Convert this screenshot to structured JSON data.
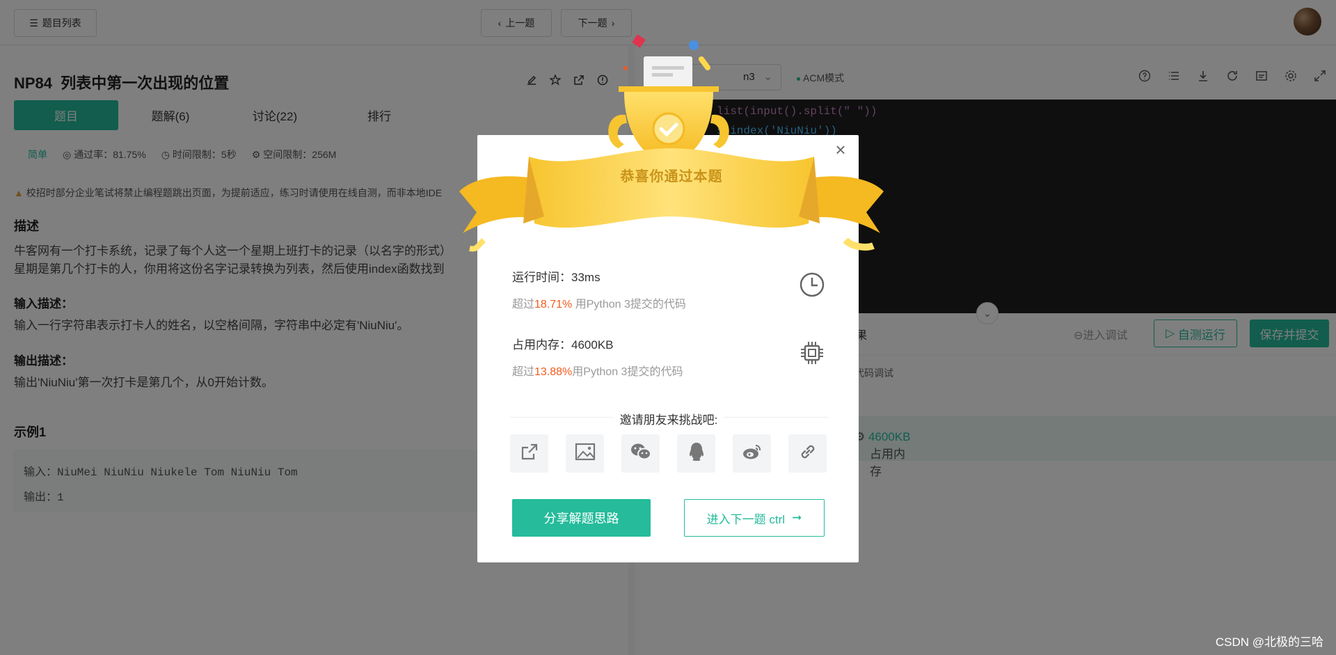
{
  "topbar": {
    "problem_list": "题目列表",
    "prev": "上一题",
    "next": "下一题"
  },
  "problem": {
    "id": "NP84",
    "title": "列表中第一次出现的位置",
    "tabs": [
      {
        "label": "题目",
        "active": true
      },
      {
        "label": "题解(6)",
        "active": false
      },
      {
        "label": "讨论(22)",
        "active": false
      },
      {
        "label": "排行",
        "active": false
      }
    ],
    "difficulty": "简单",
    "pass_rate": "通过率：81.75%",
    "time_limit": "时间限制：5秒",
    "space_limit": "空间限制：256M",
    "warning": "校招时部分企业笔试将禁止编程题跳出页面，为提前适应，练习时请使用在线自测，而非本地IDE",
    "desc_heading": "描述",
    "desc_line1": "牛客网有一个打卡系统，记录了每个人这一个星期上班打卡的记录（以名字的形式）",
    "desc_line2": "星期是第几个打卡的人，你用将这份名字记录转换为列表，然后使用index函数找到",
    "input_heading": "输入描述：",
    "input_text": "输入一行字符串表示打卡人的姓名，以空格间隔，字符串中必定有'NiuNiu'。",
    "output_heading": "输出描述：",
    "output_text": "输出'NiuNiu'第一次打卡是第几个，从0开始计数。",
    "example_heading": "示例1",
    "example_input": "输入：NiuMei NiuNiu Niukele Tom NiuNiu Tom",
    "example_output": "输出：1"
  },
  "editor": {
    "language": "n3",
    "mode": "ACM模式",
    "code_line1": "list(input().split(\" \"))",
    "code_line2": "s.index('NiuNiu'))",
    "tab_partial": "果",
    "debug": "进入调试",
    "self_run": "自测运行",
    "save_submit": "保存并提交",
    "debug_hint": "代码调试",
    "result_label": "占用内存",
    "result_value": "4600KB"
  },
  "modal": {
    "title": "恭喜你通过本题",
    "runtime_label": "运行时间：33ms",
    "runtime_beat_prefix": "超过",
    "runtime_beat_pct": "18.71%",
    "runtime_beat_suffix": " 用Python 3提交的代码",
    "memory_label": "占用内存：4600KB",
    "memory_beat_prefix": "超过",
    "memory_beat_pct": "13.88%",
    "memory_beat_suffix": "用Python 3提交的代码",
    "invite": "邀请朋友来挑战吧:",
    "share_solution": "分享解题思路",
    "next_question": "进入下一题 ctrl"
  },
  "watermark": "CSDN @北极的三哈",
  "colors": {
    "accent": "#25bb9b",
    "highlight": "#f55a1d",
    "trophy_gold": "#f7c52f"
  }
}
